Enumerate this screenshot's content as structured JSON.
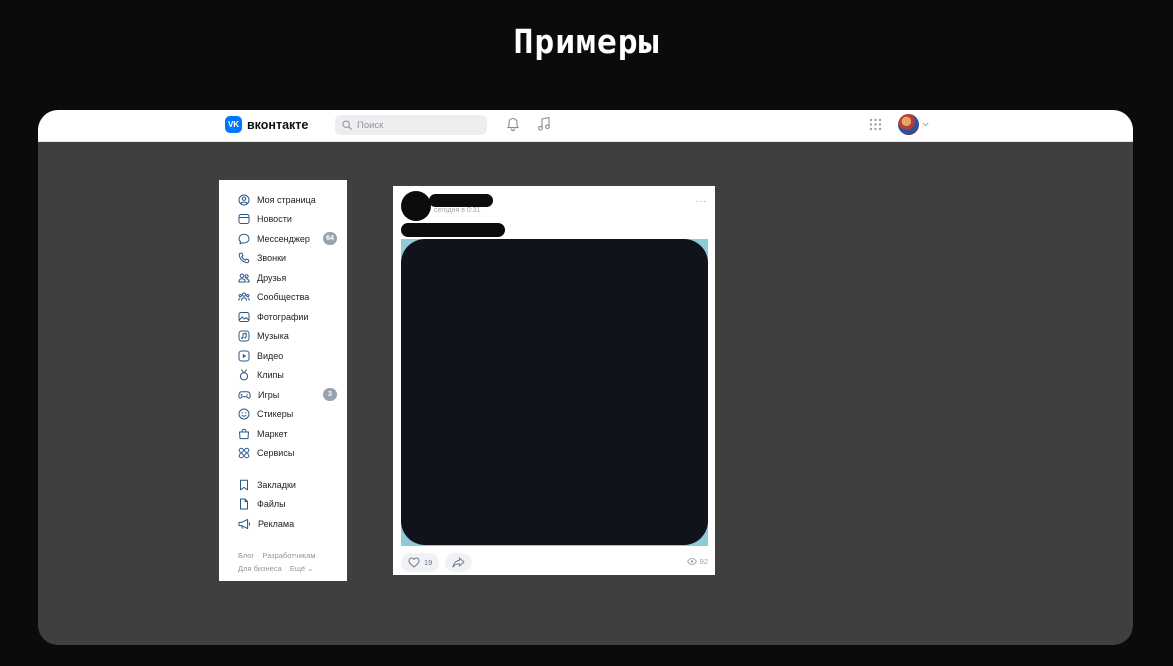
{
  "slide": {
    "title": "Примеры"
  },
  "header": {
    "logo_mark": "VK",
    "logo_text": "вконтакте",
    "search_placeholder": "Поиск",
    "accent_color": "#0077ff"
  },
  "sidebar": {
    "items": [
      {
        "label": "Моя страница",
        "icon": "user-circle-icon"
      },
      {
        "label": "Новости",
        "icon": "news-icon"
      },
      {
        "label": "Мессенджер",
        "icon": "message-icon",
        "badge": "64"
      },
      {
        "label": "Звонки",
        "icon": "phone-icon"
      },
      {
        "label": "Друзья",
        "icon": "friends-icon"
      },
      {
        "label": "Сообщества",
        "icon": "communities-icon"
      },
      {
        "label": "Фотографии",
        "icon": "photo-icon"
      },
      {
        "label": "Музыка",
        "icon": "music-icon"
      },
      {
        "label": "Видео",
        "icon": "video-icon"
      },
      {
        "label": "Клипы",
        "icon": "clips-icon"
      },
      {
        "label": "Игры",
        "icon": "gamepad-icon",
        "badge": "3"
      },
      {
        "label": "Стикеры",
        "icon": "smile-icon"
      },
      {
        "label": "Маркет",
        "icon": "bag-icon"
      },
      {
        "label": "Сервисы",
        "icon": "grid-icon"
      },
      {
        "label": "Закладки",
        "icon": "bookmark-icon"
      },
      {
        "label": "Файлы",
        "icon": "file-icon"
      },
      {
        "label": "Реклама",
        "icon": "megaphone-icon"
      }
    ],
    "footer": {
      "row1": [
        "Блог",
        "Разработчикам"
      ],
      "row2": [
        "Для бизнеса",
        "Ещё ⌄"
      ]
    }
  },
  "post": {
    "time": "сегодня в 0:31",
    "menu": "···",
    "likes": "19",
    "views": "92"
  }
}
